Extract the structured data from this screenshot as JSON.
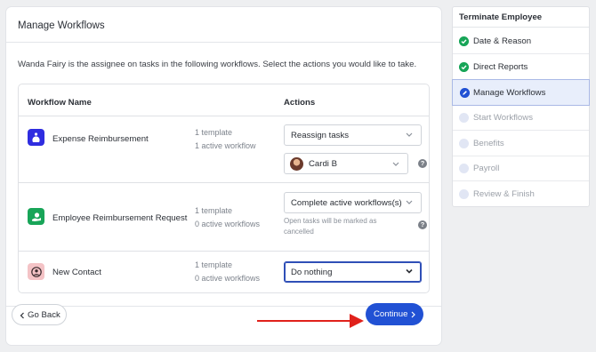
{
  "card": {
    "title": "Manage Workflows",
    "intro": "Wanda Fairy is the assignee on tasks in the following workflows. Select the actions you would like to take."
  },
  "table": {
    "headers": {
      "name": "Workflow Name",
      "actions": "Actions"
    },
    "rows": [
      {
        "name": "Expense Reimbursement",
        "templates": "1 template",
        "workflows": "1 active workflow",
        "action": "Reassign tasks",
        "assignee": "Cardi B",
        "icon": "money-bag-icon"
      },
      {
        "name": "Employee Reimbursement Request",
        "templates": "1 template",
        "workflows": "0 active workflows",
        "action": "Complete active workflows(s)",
        "note": "Open tasks will be marked as cancelled",
        "icon": "money-hand-icon"
      },
      {
        "name": "New Contact",
        "templates": "1 template",
        "workflows": "0 active workflows",
        "action": "Do nothing",
        "icon": "contact-icon"
      }
    ]
  },
  "footer": {
    "back_label": "Go Back",
    "continue_label": "Continue"
  },
  "sidebar": {
    "title": "Terminate Employee",
    "steps": [
      {
        "label": "Date & Reason",
        "status": "done"
      },
      {
        "label": "Direct Reports",
        "status": "done"
      },
      {
        "label": "Manage Workflows",
        "status": "current"
      },
      {
        "label": "Start Workflows",
        "status": "pending"
      },
      {
        "label": "Benefits",
        "status": "pending"
      },
      {
        "label": "Payroll",
        "status": "pending"
      },
      {
        "label": "Review & Finish",
        "status": "pending"
      }
    ]
  },
  "colors": {
    "primary": "#2151d4",
    "success": "#18a558",
    "annotation_arrow": "#e0211b"
  }
}
